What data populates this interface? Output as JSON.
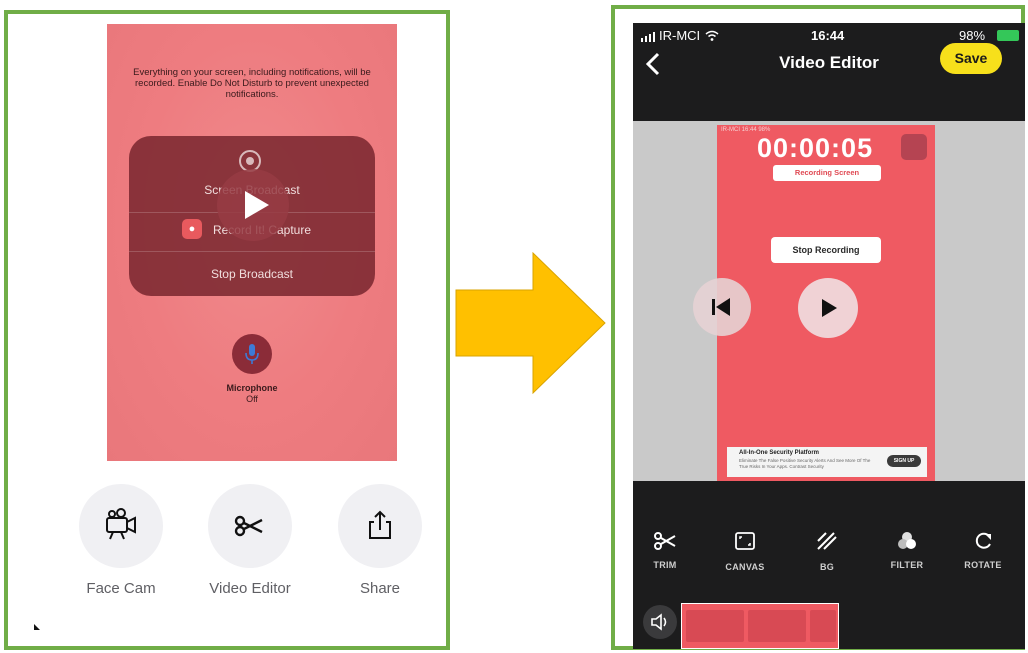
{
  "left": {
    "notice": "Everything on your screen, including notifications, will be recorded. Enable Do Not Disturb to prevent unexpected notifications.",
    "menu": {
      "broadcast_label": "Screen Broadcast",
      "capture_label": "Record It! Capture",
      "stop_label": "Stop Broadcast"
    },
    "microphone": {
      "label": "Microphone",
      "status": "Off"
    },
    "tools": [
      {
        "label": "Face Cam",
        "icon": "video-camera-icon"
      },
      {
        "label": "Video Editor",
        "icon": "scissors-icon"
      },
      {
        "label": "Share",
        "icon": "share-icon"
      }
    ]
  },
  "right": {
    "status_bar": {
      "carrier": "IR-MCI",
      "time": "16:44",
      "battery": "98%"
    },
    "header": {
      "title": "Video Editor",
      "save_label": "Save"
    },
    "preview": {
      "status": "IR-MCI   16:44   98%",
      "timer": "00:00:05",
      "recording_label": "Recording Screen",
      "stop_recording_label": "Stop Recording",
      "ad": {
        "title": "All-In-One Security Platform",
        "description": "Eliminate The False Positive Security Alerts And See More Of The True Risks In Your Apps. Contrast Security",
        "cta": "SIGN UP"
      }
    },
    "tools": [
      {
        "label": "TRIM",
        "icon": "scissors-icon"
      },
      {
        "label": "CANVAS",
        "icon": "canvas-icon"
      },
      {
        "label": "BG",
        "icon": "background-icon"
      },
      {
        "label": "FILTER",
        "icon": "filter-icon"
      },
      {
        "label": "ROTATE",
        "icon": "rotate-icon"
      }
    ]
  },
  "colors": {
    "frame_green": "#70ad47",
    "arrow_yellow": "#ffc000",
    "save_yellow": "#f7e01b",
    "record_red": "#ef5a62"
  }
}
